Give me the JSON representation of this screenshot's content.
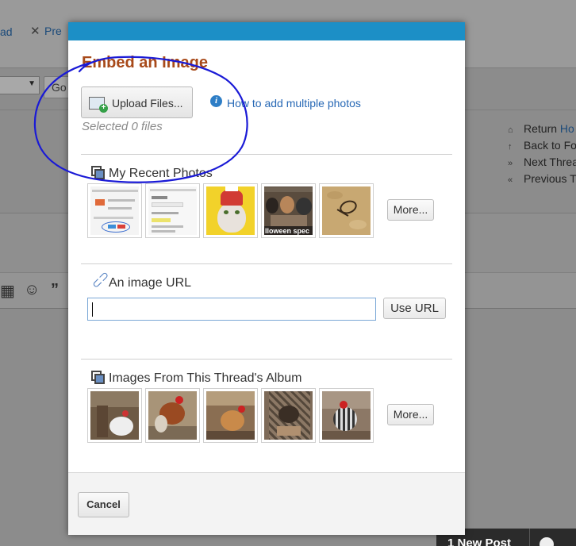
{
  "background": {
    "toolbar_left_text": "ad",
    "toolbar_preview_text": "Pre",
    "go_button_text": "Go",
    "sidebar_links": [
      {
        "prefix": "Return ",
        "link": "Ho"
      },
      {
        "prefix": "Back to Fo",
        "link": ""
      },
      {
        "prefix": "Next Threa",
        "link": ""
      },
      {
        "prefix": "Previous T",
        "link": ""
      }
    ],
    "new_post_label": "1 New Post"
  },
  "modal": {
    "title": "Embed an Image",
    "upload_button_label": "Upload Files...",
    "selected_files_text": "Selected 0 files",
    "howto_link_text": "How to add multiple photos",
    "recent_photos": {
      "heading": "My Recent Photos",
      "more_label": "More..."
    },
    "image_url": {
      "heading": "An image URL",
      "input_value": "",
      "use_url_label": "Use URL"
    },
    "album": {
      "heading": "Images From This Thread's Album",
      "more_label": "More..."
    },
    "recent_thumb4_caption": "lloween spec",
    "cancel_label": "Cancel"
  },
  "colors": {
    "modal_top_bar": "#1c8fc6",
    "title": "#a84a1a",
    "link": "#2768b5",
    "annotation_ink": "#1a1ad6"
  }
}
